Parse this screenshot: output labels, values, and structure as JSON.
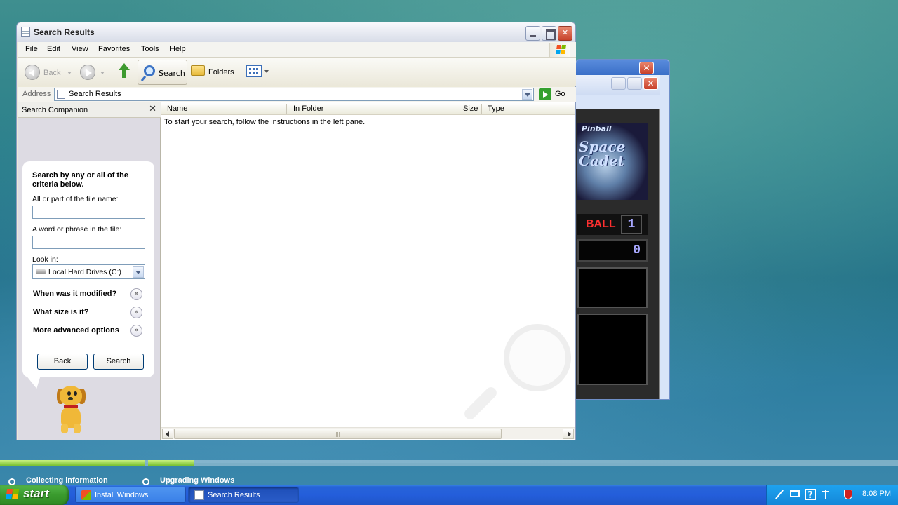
{
  "window": {
    "title": "Search Results",
    "menu": [
      "File",
      "Edit",
      "View",
      "Favorites",
      "Tools",
      "Help"
    ],
    "toolbar": {
      "back_label": "Back",
      "search_label": "Search",
      "folders_label": "Folders"
    },
    "address": {
      "label": "Address",
      "value": "Search Results",
      "go_label": "Go"
    }
  },
  "search_companion": {
    "title": "Search Companion",
    "close_glyph": "✕",
    "heading": "Search by any or all of the criteria below.",
    "filename_label": "All or part of the file name:",
    "filename_value": "",
    "phrase_label": "A word or phrase in the file:",
    "phrase_value": "",
    "lookin_label": "Look in:",
    "lookin_value": "Local Hard Drives (C:)",
    "options": [
      "When was it modified?",
      "What size is it?",
      "More advanced options"
    ],
    "chevron_glyph": "»",
    "back_button": "Back",
    "search_button": "Search"
  },
  "results": {
    "columns": [
      "Name",
      "In Folder",
      "Size",
      "Type"
    ],
    "empty_message": "To start your search, follow the instructions in the left pane."
  },
  "pinball": {
    "title_small": "Pinball",
    "title_big": "Space Cadet",
    "ball_label": "BALL",
    "ball_number": "1",
    "score": "0",
    "close_glyph": "✕"
  },
  "setup": {
    "step1": "Collecting information",
    "step2": "Upgrading Windows"
  },
  "taskbar": {
    "start_label": "start",
    "tasks": [
      "Install Windows",
      "Search Results"
    ],
    "clock": "8:08 PM"
  },
  "colors": {
    "taskbar_blue": "#245edb",
    "start_green": "#3a9b2e",
    "progress_green": "#7ac030",
    "close_red": "#c7422b"
  }
}
